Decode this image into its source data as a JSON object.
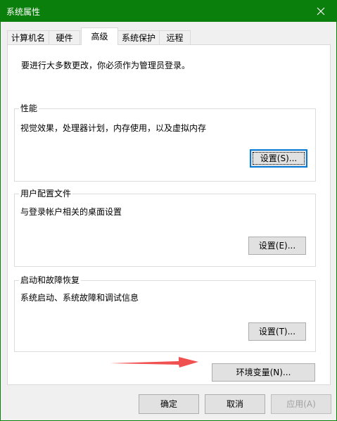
{
  "window": {
    "title": "系统属性",
    "close_label": "✕"
  },
  "tabs": [
    {
      "label": "计算机名",
      "active": false
    },
    {
      "label": "硬件",
      "active": false
    },
    {
      "label": "高级",
      "active": true
    },
    {
      "label": "系统保护",
      "active": false
    },
    {
      "label": "远程",
      "active": false
    }
  ],
  "advanced": {
    "intro": "要进行大多数更改，你必须作为管理员登录。",
    "performance": {
      "title": "性能",
      "description": "视觉效果，处理器计划，内存使用，以及虚拟内存",
      "button": "设置(S)..."
    },
    "user_profiles": {
      "title": "用户配置文件",
      "description": "与登录帐户相关的桌面设置",
      "button": "设置(E)..."
    },
    "startup_recovery": {
      "title": "启动和故障恢复",
      "description": "系统启动、系统故障和调试信息",
      "button": "设置(T)..."
    },
    "env_button": "环境变量(N)..."
  },
  "footer": {
    "ok": "确定",
    "cancel": "取消",
    "apply": "应用(A)"
  },
  "colors": {
    "titlebar": "#0b7f0b",
    "annotation_arrow": "#f0504f"
  }
}
